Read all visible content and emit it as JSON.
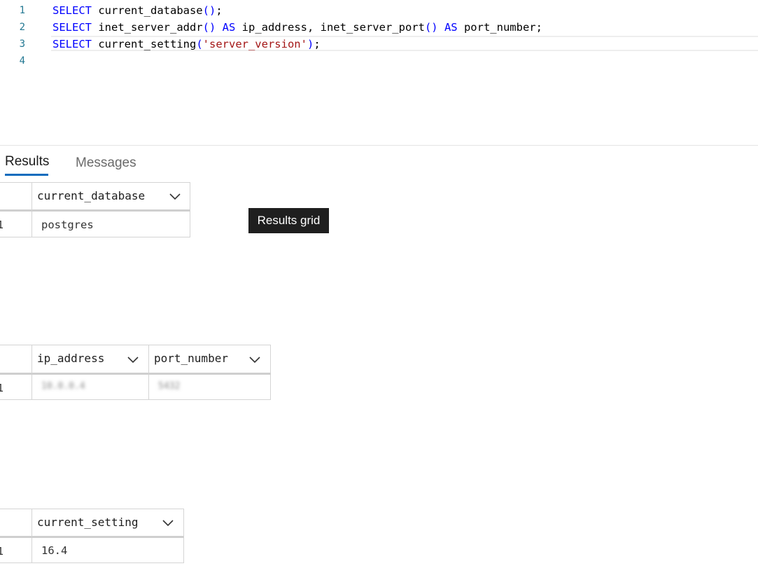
{
  "editor": {
    "lines": [
      {
        "number": "1",
        "tokens": [
          {
            "t": "SELECT",
            "k": "kw"
          },
          {
            "t": " current_database",
            "k": ""
          },
          {
            "t": "()",
            "k": "kw"
          },
          {
            "t": ";",
            "k": ""
          }
        ]
      },
      {
        "number": "2",
        "tokens": [
          {
            "t": "SELECT",
            "k": "kw"
          },
          {
            "t": " inet_server_addr",
            "k": ""
          },
          {
            "t": "()",
            "k": "kw"
          },
          {
            "t": " ",
            "k": ""
          },
          {
            "t": "AS",
            "k": "kw"
          },
          {
            "t": " ip_address, inet_server_port",
            "k": ""
          },
          {
            "t": "()",
            "k": "kw"
          },
          {
            "t": " ",
            "k": ""
          },
          {
            "t": "AS",
            "k": "kw"
          },
          {
            "t": " port_number;",
            "k": ""
          }
        ]
      },
      {
        "number": "3",
        "tokens": [
          {
            "t": "SELECT",
            "k": "kw"
          },
          {
            "t": " current_setting",
            "k": ""
          },
          {
            "t": "(",
            "k": "kw"
          },
          {
            "t": "'server_version'",
            "k": "str"
          },
          {
            "t": ")",
            "k": "kw"
          },
          {
            "t": ";",
            "k": ""
          }
        ]
      },
      {
        "number": "4",
        "tokens": []
      }
    ]
  },
  "tabs": {
    "results": "Results",
    "messages": "Messages"
  },
  "tooltip": "Results grid",
  "grids": [
    {
      "columns": [
        "current_database"
      ],
      "rows": [
        {
          "num": "1",
          "cells": [
            "postgres"
          ]
        }
      ]
    },
    {
      "columns": [
        "ip_address",
        "port_number"
      ],
      "rows": [
        {
          "num": "1",
          "cells": [
            "10.0.0.4",
            "5432"
          ]
        }
      ]
    },
    {
      "columns": [
        "current_setting"
      ],
      "rows": [
        {
          "num": "1",
          "cells": [
            "16.4"
          ]
        }
      ]
    }
  ],
  "colors": {
    "keyword": "#0000ff",
    "string": "#a31515",
    "line_number": "#237893",
    "accent": "#0f6cbd"
  },
  "icons": {
    "column_menu": "chevron-down-icon"
  }
}
